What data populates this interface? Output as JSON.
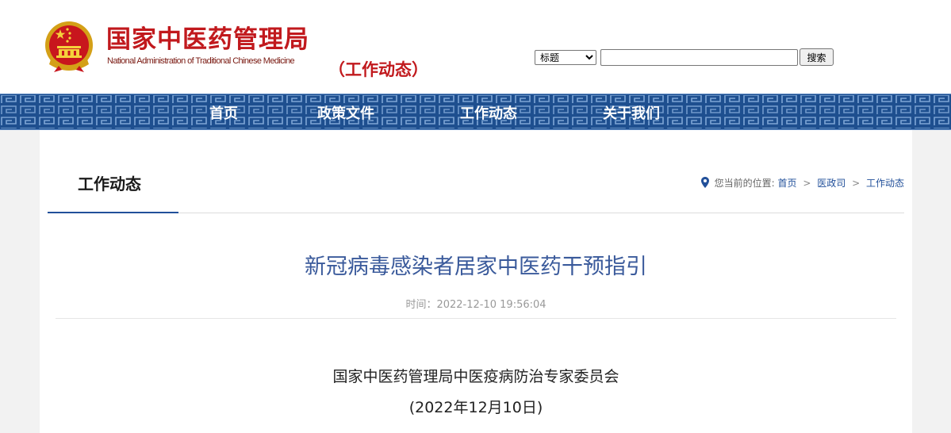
{
  "header": {
    "title": "国家中医药管理局",
    "subtitle": "National Administration of Traditional Chinese Medicine",
    "section_tag": "（工作动态）"
  },
  "search": {
    "options": [
      "标题"
    ],
    "selected": "标题",
    "query": "",
    "button_label": "搜索"
  },
  "nav": {
    "items": [
      "首页",
      "政策文件",
      "工作动态",
      "关于我们"
    ]
  },
  "column": {
    "title": "工作动态"
  },
  "breadcrumb": {
    "prefix": "您当前的位置:",
    "links": [
      "首页",
      "医政司",
      "工作动态"
    ],
    "separator": ">"
  },
  "article": {
    "title": "新冠病毒感染者居家中医药干预指引",
    "time_label": "时间：",
    "time": "2022-12-10 19:56:04",
    "body_lines": [
      "国家中医药管理局中医疫病防治专家委员会",
      "(2022年12月10日)"
    ]
  },
  "colors": {
    "brand_red": "#c1191d",
    "nav_blue": "#1e4f8f",
    "title_blue": "#3a5a9b",
    "link_blue": "#22509a"
  }
}
